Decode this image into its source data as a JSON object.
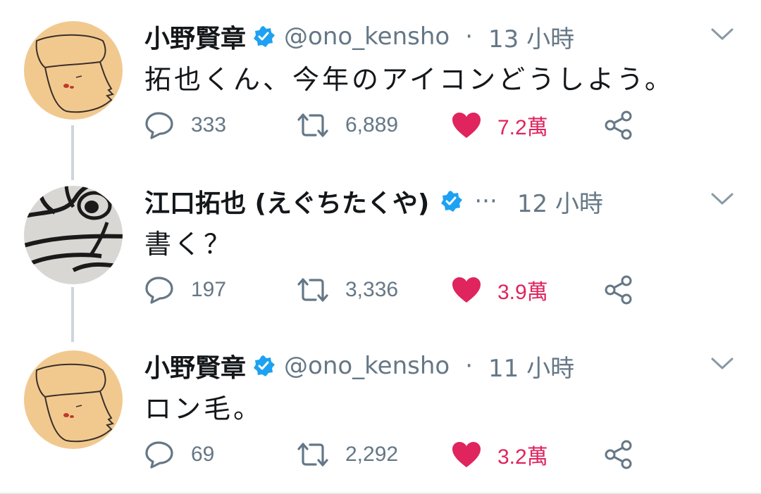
{
  "tweets": [
    {
      "display_name": "小野賢章",
      "handle": "@ono_kensho",
      "separator": "·",
      "time": "13 小時",
      "text": "拓也くん、今年のアイコンどうしよう。",
      "reply_count": "333",
      "retweet_count": "6,889",
      "like_count": "7.2萬",
      "avatar": "drawn-face-avatar"
    },
    {
      "display_name": "江口拓也 (えぐちたくや)",
      "handle": "",
      "separator": "···",
      "time": "12 小時",
      "text": "書く？",
      "reply_count": "197",
      "retweet_count": "3,336",
      "like_count": "3.9萬",
      "avatar": "sketch-closeup-avatar"
    },
    {
      "display_name": "小野賢章",
      "handle": "@ono_kensho",
      "separator": "·",
      "time": "11 小時",
      "text": "ロン毛。",
      "reply_count": "69",
      "retweet_count": "2,292",
      "like_count": "3.2萬",
      "avatar": "drawn-face-avatar"
    }
  ],
  "icons": {
    "verified": "verified-badge-icon",
    "more": "chevron-down-icon",
    "reply": "reply-bubble-icon",
    "retweet": "retweet-icon",
    "like": "heart-icon",
    "share": "share-icon"
  },
  "colors": {
    "text": "#14171a",
    "secondary": "#657786",
    "verified": "#1da1f2",
    "like": "#e0245e",
    "connector": "#cfd5da",
    "avatar_bg": "#f1c98f"
  }
}
